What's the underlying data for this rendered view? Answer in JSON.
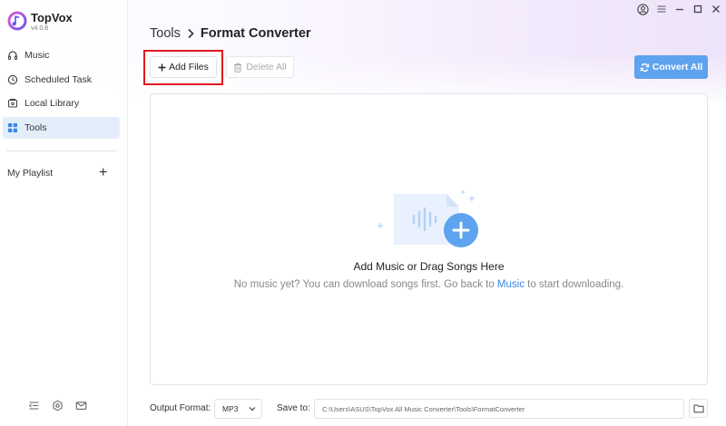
{
  "app": {
    "name": "TopVox",
    "version": "v4.0.8"
  },
  "sidebar": {
    "items": [
      {
        "label": "Music",
        "icon": "headphones-icon"
      },
      {
        "label": "Scheduled Task",
        "icon": "clock-icon"
      },
      {
        "label": "Local Library",
        "icon": "library-icon"
      },
      {
        "label": "Tools",
        "icon": "grid-icon",
        "active": true
      }
    ],
    "playlist_label": "My Playlist",
    "playlist_add": "+"
  },
  "header": {
    "breadcrumb_root": "Tools",
    "breadcrumb_current": "Format Converter"
  },
  "toolbar": {
    "add_files_label": "Add Files",
    "delete_all_label": "Delete All",
    "convert_all_label": "Convert All"
  },
  "dropzone": {
    "title": "Add Music or Drag Songs Here",
    "hint_before": "No music yet? You can download songs first. Go back to ",
    "hint_link": "Music",
    "hint_after": " to start downloading."
  },
  "footer": {
    "output_format_label": "Output Format:",
    "output_format_value": "MP3",
    "save_to_label": "Save to:",
    "save_path": "C:\\Users\\ASUS\\TopVox All Music Converter\\Tools\\FormatConverter"
  },
  "colors": {
    "accent": "#5ea3ef",
    "link": "#3b86e8",
    "active_nav_bg": "#e4eefb",
    "highlight": "#e0191f"
  }
}
